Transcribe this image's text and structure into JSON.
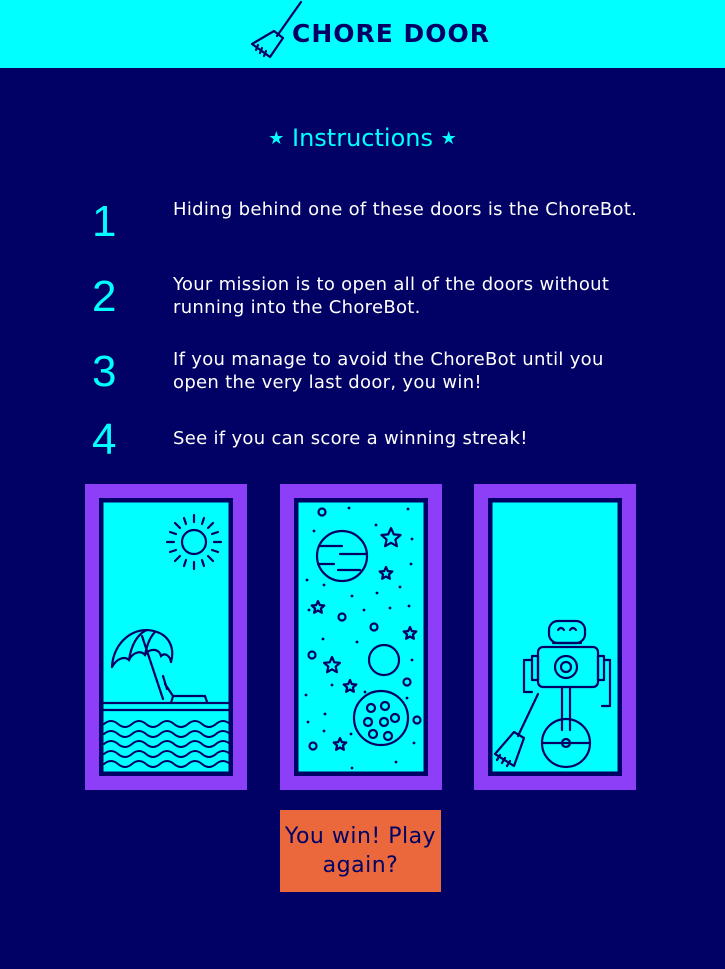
{
  "header": {
    "title": "CHORE DOOR",
    "logo_icon": "broom-icon",
    "background": "#00ffff"
  },
  "instructions": {
    "title": "Instructions",
    "star_glyph": "★",
    "steps": [
      {
        "number": "1",
        "text": "Hiding behind one of these doors is the ChoreBot."
      },
      {
        "number": "2",
        "text": "Your mission is to open all of the doors without running into the ChoreBot."
      },
      {
        "number": "3",
        "text": "If you manage to avoid the ChoreBot until you open the very last door, you win!"
      },
      {
        "number": "4",
        "text": "See if you can score a winning streak!"
      }
    ]
  },
  "doors": [
    {
      "name": "beach-door",
      "scene": "beach-icon",
      "state": "open"
    },
    {
      "name": "space-door",
      "scene": "space-icon",
      "state": "open"
    },
    {
      "name": "robot-door",
      "scene": "chorebot-icon",
      "state": "open"
    }
  ],
  "start_button": {
    "label": "You win! Play again?"
  },
  "colors": {
    "background": "#010165",
    "accent": "#00ffff",
    "door_frame": "#8c3ff7",
    "button": "#ea683c",
    "text": "#ffffff"
  }
}
